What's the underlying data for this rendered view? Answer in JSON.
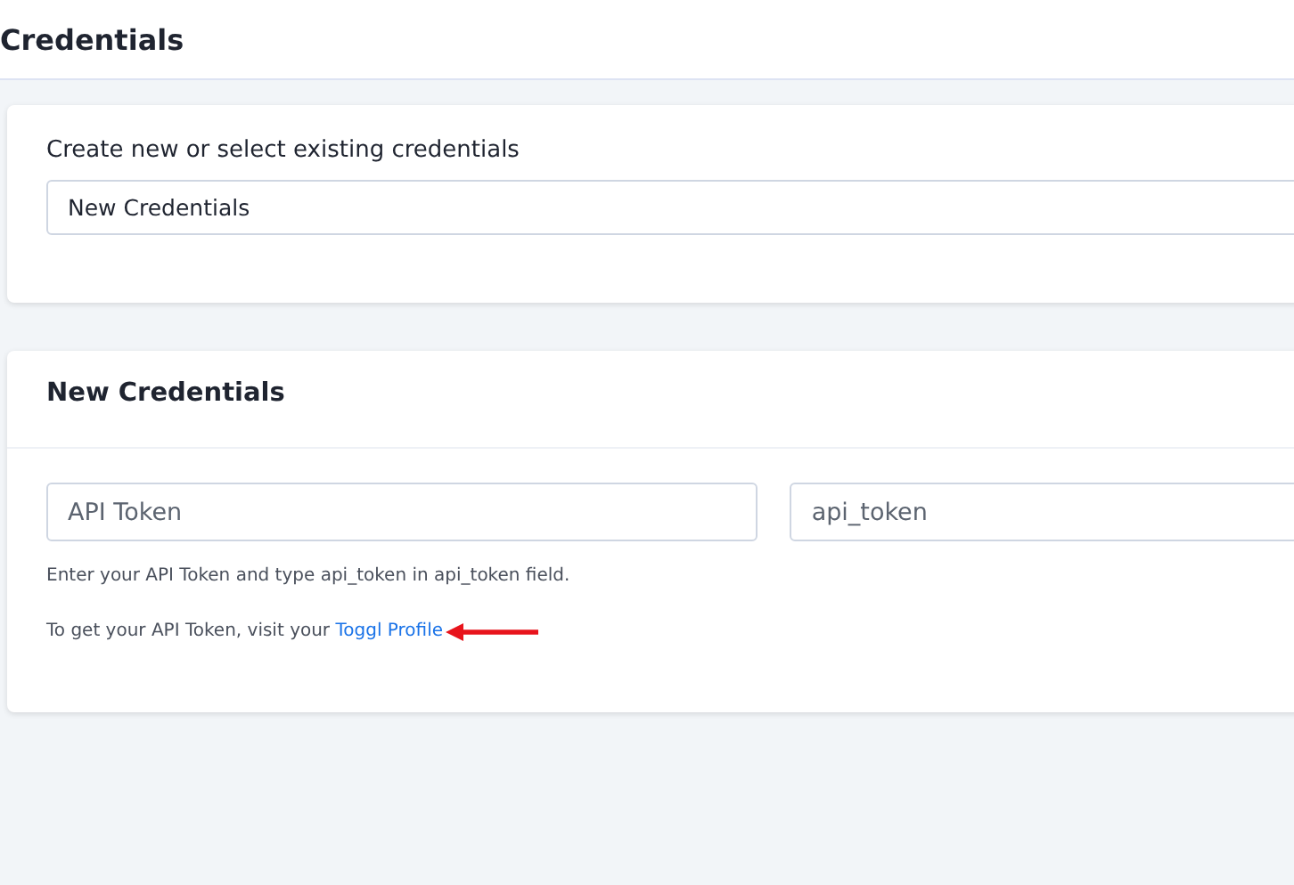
{
  "header": {
    "title": "Credentials"
  },
  "select_card": {
    "label": "Create new or select existing credentials",
    "value": "New Credentials"
  },
  "new_card": {
    "title": "New Credentials",
    "fields": [
      {
        "value": "API Token"
      },
      {
        "value": "api_token"
      }
    ],
    "help": "Enter your API Token and type api_token in api_token field.",
    "link_line": {
      "text": "To get your API Token, visit your ",
      "link": "Toggl Profile"
    }
  }
}
